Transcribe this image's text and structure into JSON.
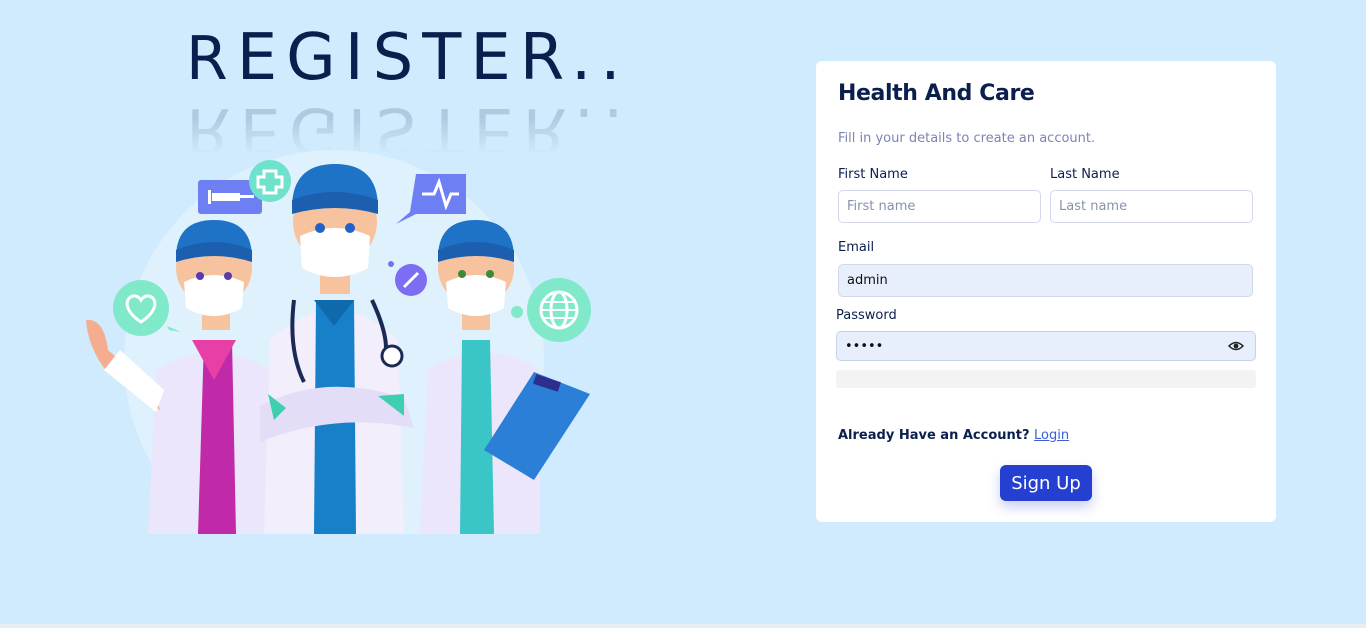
{
  "hero": {
    "title": "REGISTER..",
    "title_first": "R",
    "title_rest": "EGISTER.."
  },
  "card": {
    "title": "Health And Care",
    "subtitle": "Fill in your details to create an account.",
    "first_name": {
      "label": "First Name",
      "placeholder": "First name",
      "value": ""
    },
    "last_name": {
      "label": "Last Name",
      "placeholder": "Last name",
      "value": ""
    },
    "email": {
      "label": "Email",
      "value": "admin"
    },
    "password": {
      "label": "Password",
      "value": "•••••"
    },
    "account_prompt": "Already Have an Account?",
    "login_link": "Login",
    "signup_button": "Sign Up"
  },
  "colors": {
    "background": "#d0ebfd",
    "primary": "#2540d1",
    "heading": "#0b1f4e"
  },
  "icons": [
    "syringe-icon",
    "medical-cross-icon",
    "heartbeat-icon",
    "heart-icon",
    "link-icon",
    "globe-icon",
    "eye-icon"
  ]
}
